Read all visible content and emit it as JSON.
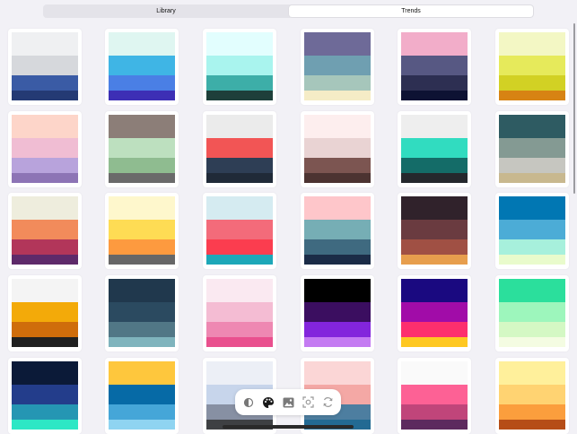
{
  "tabs": [
    {
      "label": "Library",
      "selected": false
    },
    {
      "label": "Trends",
      "selected": true
    }
  ],
  "palettes": [
    [
      "#eff0f2",
      "#d6d8dc",
      "#3a5ba5",
      "#243a74"
    ],
    [
      "#dff6f1",
      "#3fb5e5",
      "#4a7fe5",
      "#3d2fb5"
    ],
    [
      "#e2fefe",
      "#a9f4ee",
      "#3daea8",
      "#1e3f3a"
    ],
    [
      "#6e6a98",
      "#6f9fb1",
      "#a6c6bb",
      "#f5ecc6"
    ],
    [
      "#f2adc9",
      "#575883",
      "#2d2f52",
      "#0d1233"
    ],
    [
      "#f3f7c4",
      "#e6ea5b",
      "#d2d124",
      "#d78313"
    ],
    [
      "#fdd5c9",
      "#f0bdd3",
      "#b8a3dc",
      "#8d74b5"
    ],
    [
      "#8c7e78",
      "#bde0bf",
      "#8fbc90",
      "#6a6a6a"
    ],
    [
      "#ebebeb",
      "#f25555",
      "#2e3e55",
      "#202a38"
    ],
    [
      "#fdeeee",
      "#e9d3d3",
      "#7c5551",
      "#4c3331"
    ],
    [
      "#eeeeee",
      "#31dcc0",
      "#146c68",
      "#25282d"
    ],
    [
      "#2e5b62",
      "#849a93",
      "#c6c6c0",
      "#c8b88f"
    ],
    [
      "#eeeddd",
      "#f28b5b",
      "#b2365a",
      "#5e2a6a"
    ],
    [
      "#fef7cc",
      "#fedc54",
      "#fd9a3f",
      "#676767"
    ],
    [
      "#d5ebf1",
      "#f36b7a",
      "#fb3d4f",
      "#1da7b8"
    ],
    [
      "#fec6ca",
      "#76aeb5",
      "#3f6a80",
      "#1b2c47"
    ],
    [
      "#30222b",
      "#6a3b40",
      "#a05044",
      "#e79e4d"
    ],
    [
      "#0177b3",
      "#4cacd6",
      "#a7f0dc",
      "#e9fbcc"
    ],
    [
      "#f4f4f4",
      "#f3aa09",
      "#cf6d0b",
      "#202020"
    ],
    [
      "#20384d",
      "#2b4a60",
      "#517786",
      "#7fb4bd"
    ],
    [
      "#fae9f1",
      "#f4bcd3",
      "#ee88b2",
      "#e9508e"
    ],
    [
      "#000000",
      "#3b0e60",
      "#8325dc",
      "#c47bf2"
    ],
    [
      "#1a0980",
      "#a10ca8",
      "#fd2f6e",
      "#fec822"
    ],
    [
      "#2bdf9c",
      "#9df6bc",
      "#d4f8c4",
      "#f4fce2"
    ],
    [
      "#0b1a38",
      "#233d8b",
      "#2596b3",
      "#2de7c5"
    ],
    [
      "#fec73d",
      "#066aa6",
      "#45a6d8",
      "#8fd4f1"
    ],
    [
      "#eceff6",
      "#c7d5eb",
      "#8790a3",
      "#3e4043"
    ],
    [
      "#fbd6d6",
      "#f4a8a5",
      "#4d7ea0",
      "#236a93"
    ],
    [
      "#fafafa",
      "#fd6195",
      "#c0457a",
      "#5d2a5e"
    ],
    [
      "#fff09b",
      "#ffd372",
      "#fb9e3d",
      "#b64d17"
    ]
  ],
  "toolbar": [
    {
      "icon": "contrast-icon"
    },
    {
      "icon": "palette-icon"
    },
    {
      "icon": "image-icon"
    },
    {
      "icon": "camera-scan-icon"
    },
    {
      "icon": "refresh-icon"
    }
  ]
}
